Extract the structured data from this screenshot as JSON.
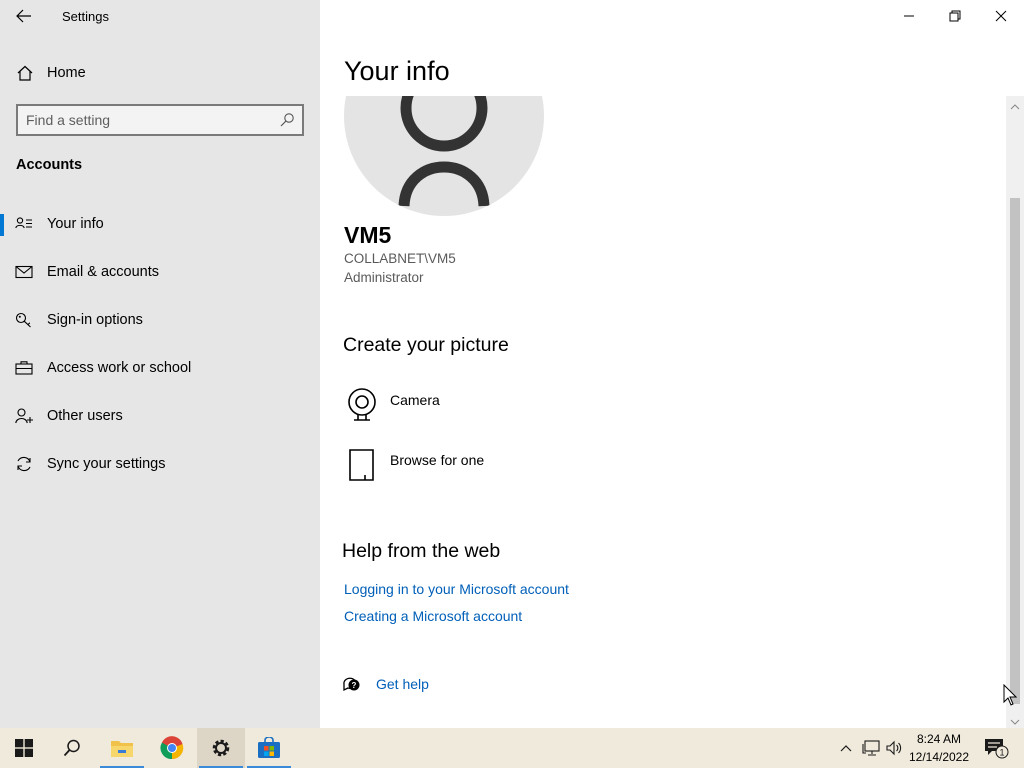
{
  "window": {
    "title": "Settings"
  },
  "sidebar": {
    "home_label": "Home",
    "search_placeholder": "Find a setting",
    "section_title": "Accounts",
    "items": [
      {
        "label": "Your info",
        "icon": "person-card-icon",
        "active": true
      },
      {
        "label": "Email & accounts",
        "icon": "mail-icon",
        "active": false
      },
      {
        "label": "Sign-in options",
        "icon": "key-icon",
        "active": false
      },
      {
        "label": "Access work or school",
        "icon": "briefcase-icon",
        "active": false
      },
      {
        "label": "Other users",
        "icon": "person-add-icon",
        "active": false
      },
      {
        "label": "Sync your settings",
        "icon": "sync-icon",
        "active": false
      }
    ]
  },
  "main": {
    "page_title": "Your info",
    "user": {
      "name": "VM5",
      "domain": "COLLABNET\\VM5",
      "role": "Administrator"
    },
    "create_picture": {
      "heading": "Create your picture",
      "options": [
        {
          "label": "Camera",
          "icon": "webcam-icon"
        },
        {
          "label": "Browse for one",
          "icon": "document-icon"
        }
      ]
    },
    "help": {
      "heading": "Help from the web",
      "links": [
        "Logging in to your Microsoft account",
        "Creating a Microsoft account"
      ],
      "get_help": "Get help"
    }
  },
  "taskbar": {
    "apps": [
      {
        "name": "Start",
        "icon": "windows-start-icon"
      },
      {
        "name": "Search",
        "icon": "search-icon"
      },
      {
        "name": "File Explorer",
        "icon": "folder-icon"
      },
      {
        "name": "Google Chrome",
        "icon": "chrome-icon"
      },
      {
        "name": "Settings",
        "icon": "gear-icon"
      },
      {
        "name": "Microsoft Store",
        "icon": "store-icon"
      }
    ],
    "clock": {
      "time": "8:24 AM",
      "date": "12/14/2022"
    },
    "notification_count": "1"
  },
  "colors": {
    "accent": "#0078d4",
    "link": "#005fb8",
    "sidebar_bg": "#e6e6e6",
    "taskbar_bg": "#f0eadc"
  }
}
